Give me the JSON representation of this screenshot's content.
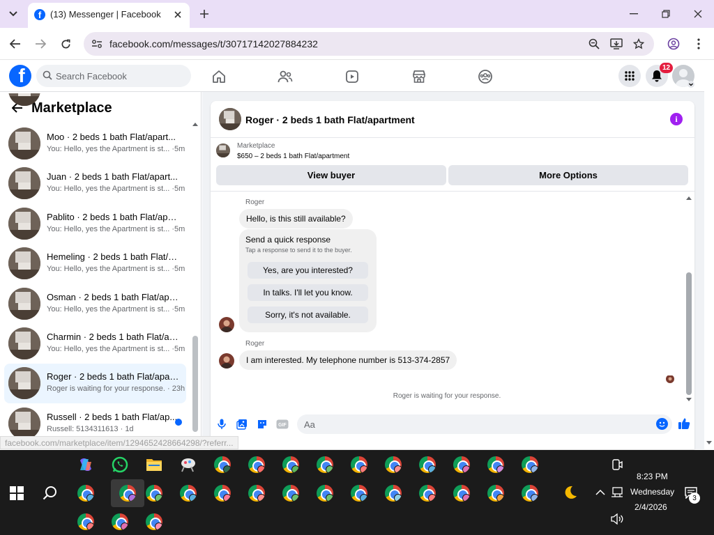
{
  "browser": {
    "tab_title": "(13) Messenger | Facebook",
    "url": "facebook.com/messages/t/30717142027884232",
    "status_url": "facebook.com/marketplace/item/1294652428664298/?referr..."
  },
  "fb_header": {
    "search_placeholder": "Search Facebook",
    "notification_count": "12"
  },
  "sidebar": {
    "title": "Marketplace",
    "conversations": [
      {
        "name": "Moo · 2 beds 1 bath Flat/apart...",
        "preview": "You: Hello, yes the Apartment is st... ·5m"
      },
      {
        "name": "Juan · 2 beds 1 bath Flat/apart...",
        "preview": "You: Hello, yes the Apartment is st... ·5m"
      },
      {
        "name": "Pablito · 2 beds 1 bath Flat/apar...",
        "preview": "You: Hello, yes the Apartment is st... ·5m"
      },
      {
        "name": "Hemeling · 2 beds 1 bath Flat/a...",
        "preview": "You: Hello, yes the Apartment is st... ·5m"
      },
      {
        "name": "Osman · 2 beds 1 bath Flat/apar...",
        "preview": "You: Hello, yes the Apartment is st... ·5m"
      },
      {
        "name": "Charmin · 2 beds 1 bath Flat/ap...",
        "preview": "You: Hello, yes the Apartment is st... ·5m"
      },
      {
        "name": "Roger · 2 beds 1 bath Flat/apart...",
        "preview": "Roger is waiting for your response. · 23h"
      },
      {
        "name": "Russell · 2 beds 1 bath Flat/ap...",
        "preview": "Russell: 5134311613 · 1d"
      }
    ]
  },
  "chat": {
    "title": "Roger · 2 beds 1 bath Flat/apartment",
    "marketplace_label": "Marketplace",
    "listing": "$650 – 2 beds 1 bath Flat/apartment",
    "view_buyer": "View buyer",
    "more_options": "More Options",
    "sender_1": "Roger",
    "message_1": "Hello, is this still available?",
    "quick_response_title": "Send a quick response",
    "quick_response_sub": "Tap a response to send it to the buyer.",
    "quick_responses": [
      "Yes, are you interested?",
      "In talks. I'll let you know.",
      "Sorry, it's not available."
    ],
    "sender_2": "Roger",
    "message_2": "I am interested. My telephone number is 513-374-2857",
    "waiting": "Roger is waiting for your response.",
    "composer_placeholder": "Aa"
  },
  "taskbar": {
    "time": "8:23 PM",
    "day": "Wednesday",
    "date": "2/4/2026",
    "notification_count": "3"
  },
  "colors": {
    "fb_blue": "#0866ff",
    "tabbar": "#eadff7",
    "active_conversation": "#ebf5ff",
    "info_purple": "#a020f0",
    "unread_dot": "#0866ff",
    "badge_red": "#e41e3f",
    "taskbar": "#1b1b1b"
  }
}
